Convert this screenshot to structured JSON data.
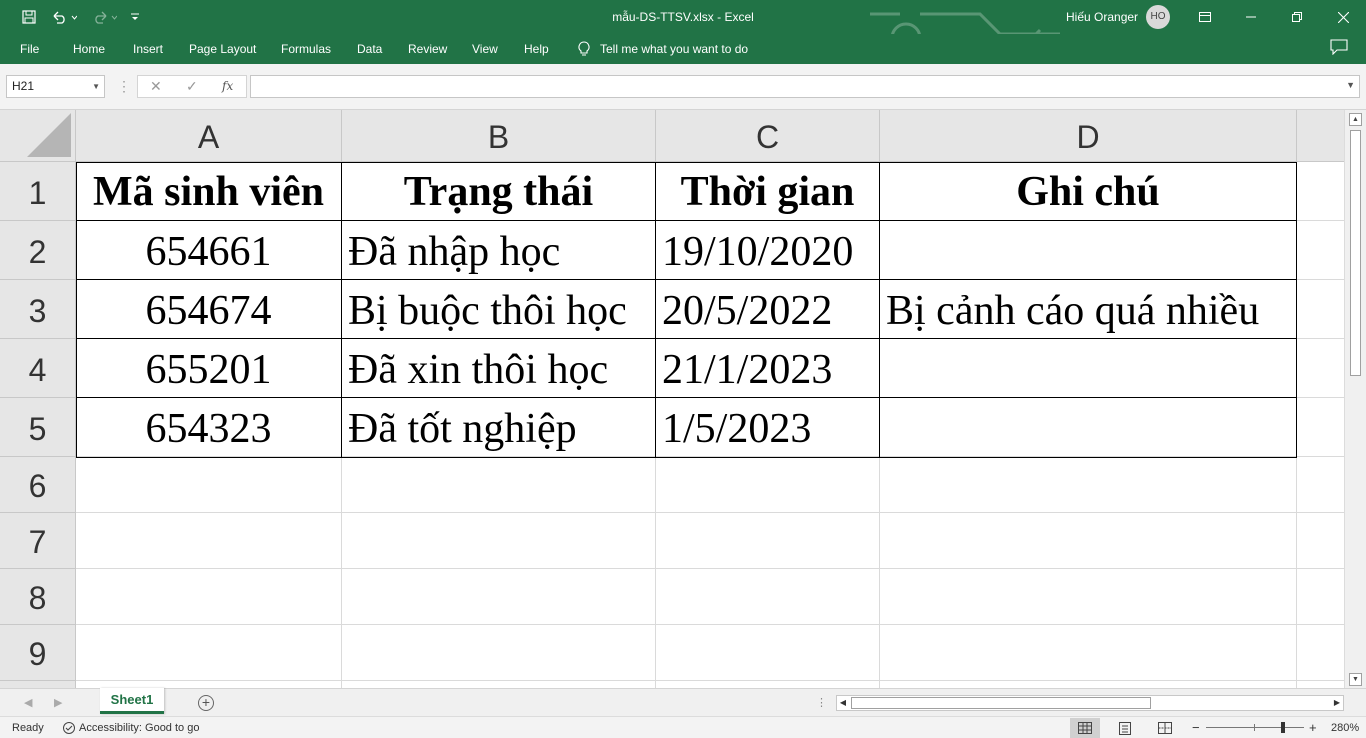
{
  "window": {
    "title": "mẫu-DS-TTSV.xlsx  -  Excel",
    "user_name": "Hiếu Oranger",
    "user_initials": "HO",
    "accent_color": "#217346"
  },
  "quick_access": {
    "icons": [
      "save-icon",
      "undo-icon",
      "redo-icon",
      "customize-icon"
    ]
  },
  "ribbon": {
    "tabs": [
      "File",
      "Home",
      "Insert",
      "Page Layout",
      "Formulas",
      "Data",
      "Review",
      "View",
      "Help"
    ],
    "tell_me": "Tell me what you want to do"
  },
  "formula_bar": {
    "name_box": "H21",
    "cancel_symbol": "✕",
    "enter_symbol": "✓",
    "fx_symbol": "fx",
    "content": ""
  },
  "sheet": {
    "columns": [
      "A",
      "B",
      "C",
      "D"
    ],
    "rows": [
      "1",
      "2",
      "3",
      "4",
      "5",
      "6",
      "7",
      "8",
      "9"
    ],
    "header_row": [
      "Mã sinh viên",
      "Trạng thái",
      "Thời gian",
      "Ghi chú"
    ],
    "data_rows": [
      [
        "654661",
        "Đã nhập học",
        "19/10/2020",
        ""
      ],
      [
        "654674",
        "Bị buộc thôi học",
        "20/5/2022",
        "Bị cảnh cáo quá nhiều"
      ],
      [
        "655201",
        "Đã xin thôi học",
        "21/1/2023",
        ""
      ],
      [
        "654323",
        "Đã tốt nghiệp",
        "1/5/2023",
        ""
      ]
    ]
  },
  "sheet_tabs": {
    "active": "Sheet1",
    "add_symbol": "+"
  },
  "status_bar": {
    "mode": "Ready",
    "accessibility": "Accessibility: Good to go",
    "zoom": "280%",
    "zoom_level_percent": 280,
    "zoom_minus": "−",
    "zoom_plus": "+"
  }
}
